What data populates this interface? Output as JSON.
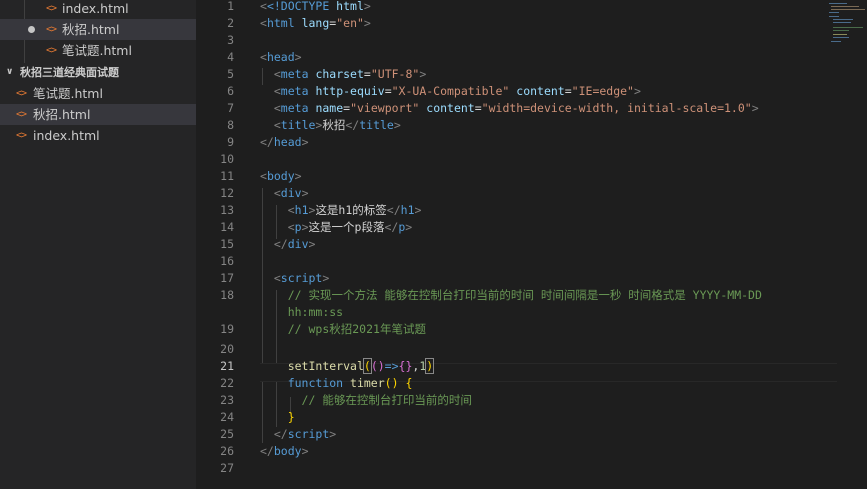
{
  "explorer": {
    "open_files": [
      {
        "name": "index.html",
        "icon": "<>"
      },
      {
        "name": "秋招.html",
        "icon": "<>",
        "modified": true
      },
      {
        "name": "笔试题.html",
        "icon": "<>"
      }
    ],
    "folder": {
      "name": "秋招三道经典面试题",
      "expanded": true
    },
    "folder_files": [
      {
        "name": "笔试题.html",
        "icon": "<>"
      },
      {
        "name": "秋招.html",
        "icon": "<>",
        "selected": true
      },
      {
        "name": "index.html",
        "icon": "<>"
      }
    ]
  },
  "editor": {
    "active_line": 21,
    "line_numbers": [
      "1",
      "2",
      "3",
      "4",
      "5",
      "6",
      "7",
      "8",
      "9",
      "10",
      "11",
      "12",
      "13",
      "14",
      "15",
      "16",
      "17",
      "18",
      "",
      "19",
      "20",
      "21",
      "22",
      "23",
      "24",
      "25",
      "26",
      "27"
    ],
    "code": {
      "l1_doctype": "<!DOCTYPE",
      "l1_html": " html",
      "l1_end": ">",
      "l2_tag": "html",
      "l2_attr": "lang",
      "l2_val": "\"en\"",
      "l4_tag": "head",
      "l5_tag": "meta",
      "l5_attr": "charset",
      "l5_val": "\"UTF-8\"",
      "l6_tag": "meta",
      "l6_attr1": "http-equiv",
      "l6_val1": "\"X-UA-Compatible\"",
      "l6_attr2": "content",
      "l6_val2": "\"IE=edge\"",
      "l7_tag": "meta",
      "l7_attr1": "name",
      "l7_val1": "\"viewport\"",
      "l7_attr2": "content",
      "l7_val2": "\"width=device-width, initial-scale=1.0\"",
      "l8_tag": "title",
      "l8_text": "秋招",
      "l9_tag": "head",
      "l11_tag": "body",
      "l12_tag": "div",
      "l13_tag": "h1",
      "l13_text": "这是h1的标签",
      "l14_tag": "p",
      "l14_text": "这是一个p段落",
      "l15_tag": "div",
      "l17_tag": "script",
      "l18_comment": "// 实现一个方法 能够在控制台打印当前的时间 时间间隔是一秒 时间格式是 YYYY-MM-DD",
      "l18b_comment": "hh:mm:ss",
      "l19_comment": "// wps秋招2021年笔试题",
      "l21_fn": "setInterval",
      "l21_arrow": "=>",
      "l21_num": "1",
      "l22_kw": "function",
      "l22_fn": "timer",
      "l23_comment": "// 能够在控制台打印当前的时间",
      "l25_tag": "script",
      "l26_tag": "body"
    }
  }
}
